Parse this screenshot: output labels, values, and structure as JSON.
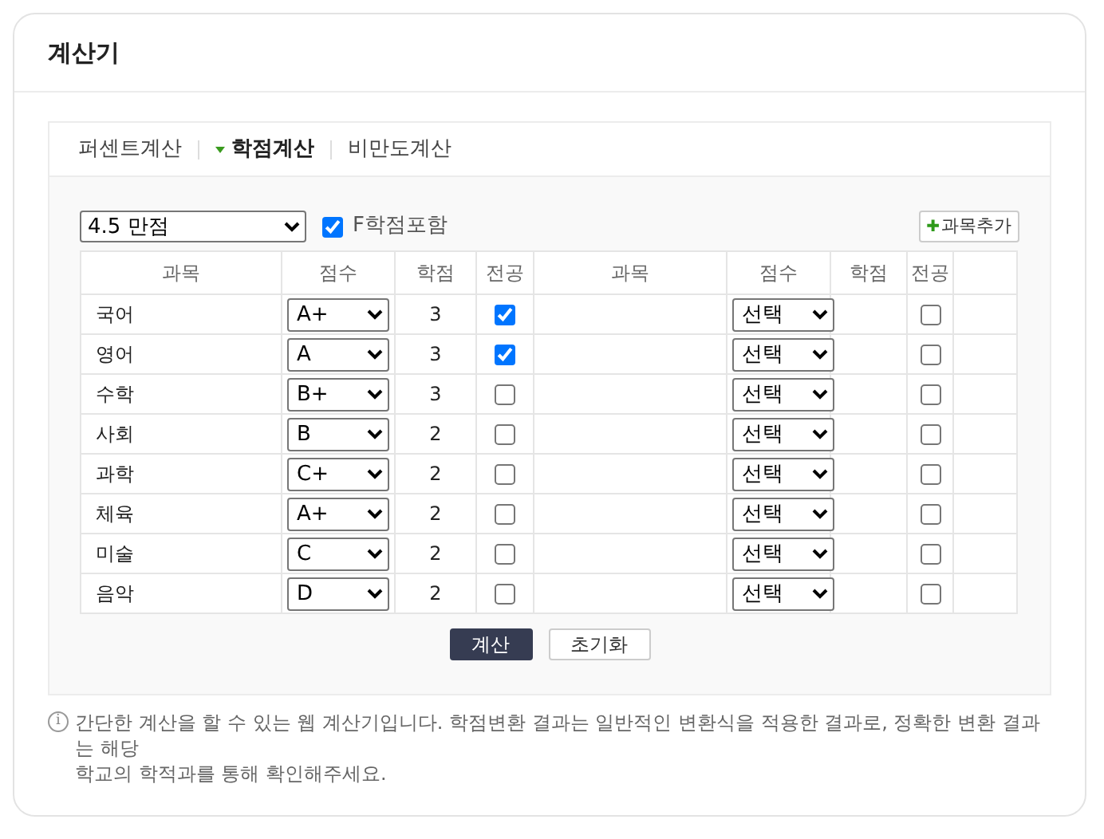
{
  "title": "계산기",
  "tabs": [
    {
      "label": "퍼센트계산",
      "selected": false
    },
    {
      "label": "학점계산",
      "selected": true
    },
    {
      "label": "비만도계산",
      "selected": false
    }
  ],
  "scale_select": {
    "value": "4.5 만점"
  },
  "include_f": {
    "label": "F학점포함",
    "checked": true
  },
  "add_button": {
    "icon": "✚",
    "label": "과목추가"
  },
  "table": {
    "columns": [
      "과목",
      "점수",
      "학점",
      "전공",
      "과목",
      "점수",
      "학점",
      "전공"
    ],
    "rows": [
      {
        "left": {
          "subject": "국어",
          "grade": "A+",
          "credit": "3",
          "major": true
        },
        "right": {
          "grade": "선택",
          "major": false
        }
      },
      {
        "left": {
          "subject": "영어",
          "grade": "A",
          "credit": "3",
          "major": true
        },
        "right": {
          "grade": "선택",
          "major": false
        }
      },
      {
        "left": {
          "subject": "수학",
          "grade": "B+",
          "credit": "3",
          "major": false
        },
        "right": {
          "grade": "선택",
          "major": false
        }
      },
      {
        "left": {
          "subject": "사회",
          "grade": "B",
          "credit": "2",
          "major": false
        },
        "right": {
          "grade": "선택",
          "major": false
        }
      },
      {
        "left": {
          "subject": "과학",
          "grade": "C+",
          "credit": "2",
          "major": false
        },
        "right": {
          "grade": "선택",
          "major": false
        }
      },
      {
        "left": {
          "subject": "체육",
          "grade": "A+",
          "credit": "2",
          "major": false
        },
        "right": {
          "grade": "선택",
          "major": false
        }
      },
      {
        "left": {
          "subject": "미술",
          "grade": "C",
          "credit": "2",
          "major": false
        },
        "right": {
          "grade": "선택",
          "major": false
        }
      },
      {
        "left": {
          "subject": "음악",
          "grade": "D",
          "credit": "2",
          "major": false
        },
        "right": {
          "grade": "선택",
          "major": false
        }
      }
    ]
  },
  "buttons": [
    {
      "kind": "primary",
      "label": "계산"
    },
    {
      "kind": "secondary",
      "label": "초기화"
    }
  ],
  "notice": {
    "icon": "i",
    "lines": [
      "간단한 계산을 할 수 있는 웹 계산기입니다. 학점변환 결과는 일반적인 변환식을 적용한 결과로, 정확한 변환 결과는 해당",
      "학교의 학적과를 통해 확인해주세요."
    ]
  }
}
